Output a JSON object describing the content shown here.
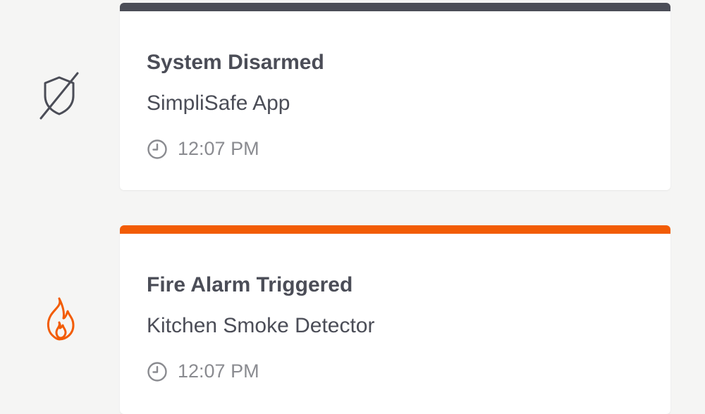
{
  "events": [
    {
      "title": "System Disarmed",
      "source": "SimpliSafe App",
      "time": "12:07 PM",
      "icon": "shield-off-icon",
      "accent_color": "#4b4d57"
    },
    {
      "title": "Fire Alarm Triggered",
      "source": "Kitchen Smoke Detector",
      "time": "12:07 PM",
      "icon": "flame-icon",
      "accent_color": "#f25c05"
    }
  ]
}
